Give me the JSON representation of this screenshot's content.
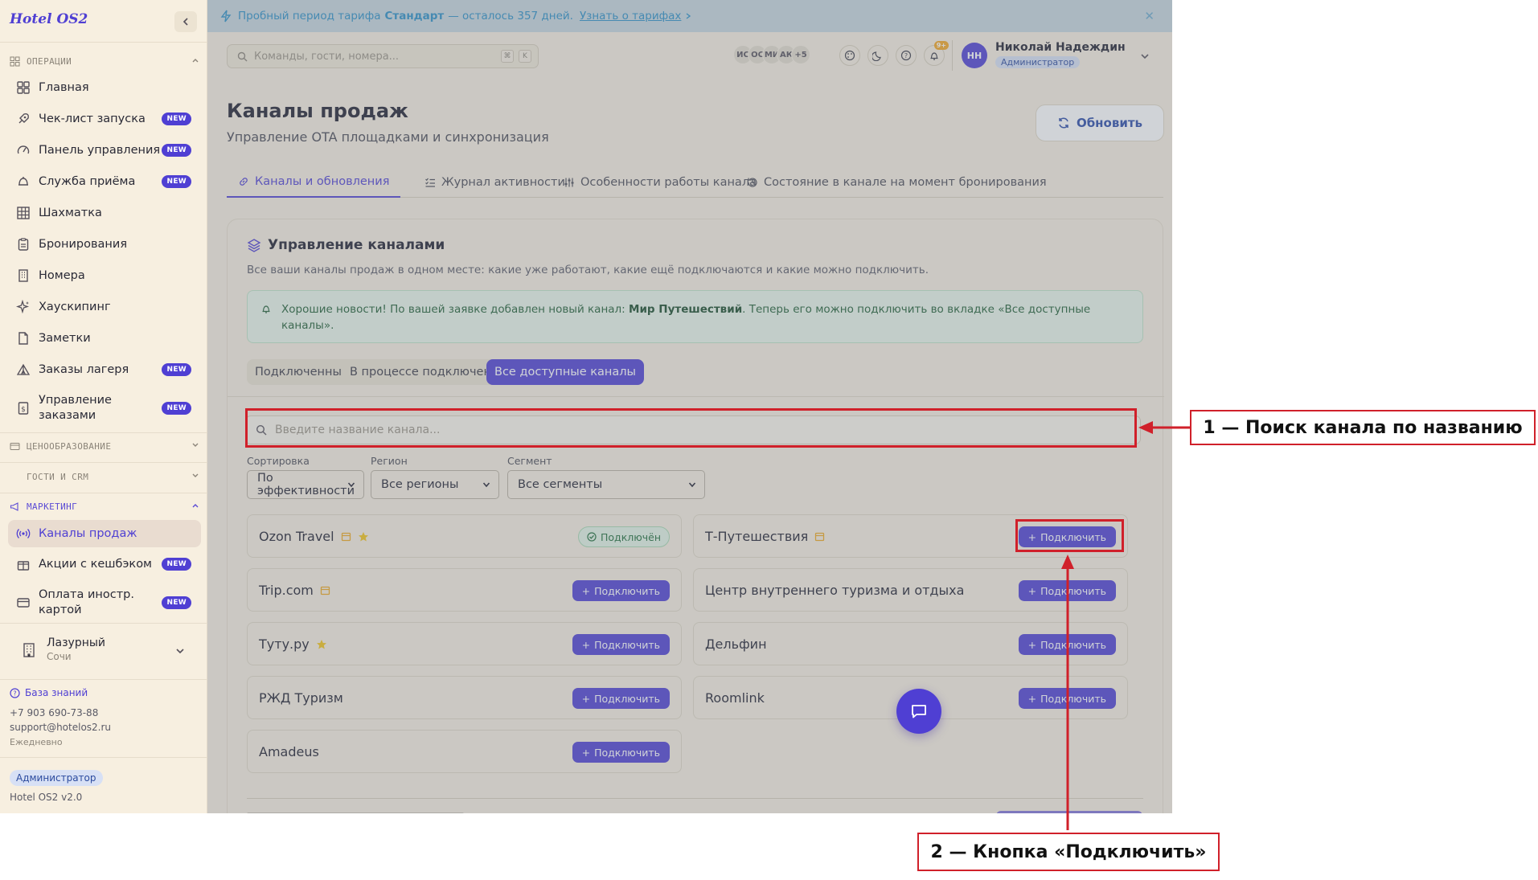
{
  "app": {
    "logo": "Hotel OS2"
  },
  "colors": {
    "accent": "#4f3fd3",
    "annotation": "#d0202a",
    "background": "#f7efe0"
  },
  "sidebar": {
    "sections": [
      {
        "label": "ОПЕРАЦИИ",
        "icon": "grid-icon",
        "expanded": true
      },
      {
        "label": "ЦЕНООБРАЗОВАНИЕ",
        "icon": "card-icon",
        "expanded": false
      },
      {
        "label": "ГОСТИ И CRM",
        "icon": "",
        "expanded": false
      },
      {
        "label": "МАРКЕТИНГ",
        "icon": "megaphone-icon",
        "expanded": true
      }
    ],
    "items": [
      {
        "label": "Главная",
        "icon": "grid-icon",
        "badge": ""
      },
      {
        "label": "Чек-лист запуска",
        "icon": "rocket-icon",
        "badge": "NEW"
      },
      {
        "label": "Панель управления",
        "icon": "gauge-icon",
        "badge": "NEW"
      },
      {
        "label": "Служба приёма",
        "icon": "bell-icon",
        "badge": "NEW"
      },
      {
        "label": "Шахматка",
        "icon": "table-icon",
        "badge": ""
      },
      {
        "label": "Бронирования",
        "icon": "clipboard-icon",
        "badge": ""
      },
      {
        "label": "Номера",
        "icon": "building-icon",
        "badge": ""
      },
      {
        "label": "Хаускипинг",
        "icon": "sparkle-icon",
        "badge": ""
      },
      {
        "label": "Заметки",
        "icon": "note-icon",
        "badge": ""
      },
      {
        "label": "Заказы лагеря",
        "icon": "tent-icon",
        "badge": "NEW"
      },
      {
        "label": "Управление заказами",
        "icon": "dollar-doc-icon",
        "badge": "NEW"
      },
      {
        "label": "Каналы продаж",
        "icon": "broadcast-icon",
        "badge": "",
        "active": true
      },
      {
        "label": "Акции с кешбэком",
        "icon": "gift-icon",
        "badge": "NEW"
      },
      {
        "label": "Оплата иностр. картой",
        "icon": "credit-card-icon",
        "badge": "NEW"
      }
    ],
    "hotel": {
      "name": "Лазурный",
      "city": "Сочи"
    },
    "knowledge_base": "База знаний",
    "phone": "+7 903 690-73-88",
    "email": "support@hotelos2.ru",
    "schedule": "Ежедневно",
    "role": "Администратор",
    "version": "Hotel OS2 v2.0"
  },
  "trial": {
    "prefix": "Пробный период тарифа",
    "plan": "Стандарт",
    "suffix": "— осталось 357 дней.",
    "link": "Узнать о тарифах"
  },
  "topbar": {
    "search_placeholder": "Команды, гости, номера...",
    "kbd": [
      "⌘",
      "K"
    ],
    "avatars": [
      "ИС",
      "ОС",
      "МИ",
      "АК",
      "+5"
    ],
    "notif_count": "9+",
    "user": {
      "initials": "НН",
      "name": "Николай Надеждин",
      "role": "Администратор"
    }
  },
  "page": {
    "title": "Каналы продаж",
    "subtitle": "Управление OTA площадками и синхронизация",
    "refresh_label": "Обновить"
  },
  "tabs": [
    {
      "label": "Каналы и обновления",
      "icon": "link-icon",
      "active": true
    },
    {
      "label": "Журнал активности",
      "icon": "list-check-icon"
    },
    {
      "label": "Особенности работы канала",
      "icon": "sliders-icon"
    },
    {
      "label": "Состояние в канале на момент бронирования",
      "icon": "history-icon"
    }
  ],
  "channels_card": {
    "title": "Управление каналами",
    "subtitle": "Все ваши каналы продаж в одном месте: какие уже работают, какие ещё подключаются и какие можно подключить.",
    "notice": {
      "before": "Хорошие новости! По вашей заявке добавлен новый канал:",
      "highlight": "Мир Путешествий",
      "after": ". Теперь его можно подключить во вкладке «Все доступные каналы»."
    },
    "segments": [
      {
        "label": "Подключенные"
      },
      {
        "label": "В процессе подключения"
      },
      {
        "label": "Все доступные каналы",
        "active": true
      }
    ],
    "search_placeholder": "Введите название канала...",
    "filters": [
      {
        "label": "Сортировка",
        "value": "По эффективности"
      },
      {
        "label": "Регион",
        "value": "Все регионы"
      },
      {
        "label": "Сегмент",
        "value": "Все сегменты"
      }
    ],
    "connect_label": "Подключить",
    "connected_label": "Подключён",
    "channels": [
      {
        "name": "Ozon Travel",
        "calendar_icon": true,
        "star": true,
        "status": "connected"
      },
      {
        "name": "Т-Путешествия",
        "calendar_icon": true,
        "star": false,
        "status": "available"
      },
      {
        "name": "Trip.com",
        "calendar_icon": true,
        "star": false,
        "status": "available"
      },
      {
        "name": "Центр внутреннего туризма и отдыха",
        "calendar_icon": false,
        "star": false,
        "status": "available"
      },
      {
        "name": "Туту.ру",
        "calendar_icon": false,
        "star": true,
        "status": "available"
      },
      {
        "name": "Дельфин",
        "calendar_icon": false,
        "star": false,
        "status": "available"
      },
      {
        "name": "РЖД Туризм",
        "calendar_icon": false,
        "star": false,
        "status": "available"
      },
      {
        "name": "Roomlink",
        "calendar_icon": false,
        "star": false,
        "status": "available"
      },
      {
        "name": "Amadeus",
        "calendar_icon": false,
        "star": false,
        "status": "available"
      }
    ]
  },
  "annotations": [
    {
      "label": "1 — Поиск канала по названию"
    },
    {
      "label": "2 — Кнопка «Подключить»"
    }
  ]
}
